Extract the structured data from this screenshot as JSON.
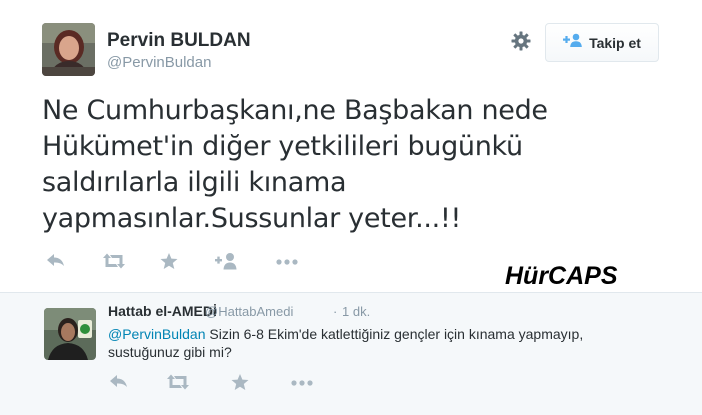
{
  "tweet": {
    "author_name": "Pervin BULDAN",
    "author_handle": "@PervinBuldan",
    "follow_label": "Takip et",
    "text_lines": [
      "Ne Cumhurbaşkanı,ne Başbakan nede",
      "Hükümet'in diğer yetkilileri bugünkü",
      "saldırılarla ilgili kınama",
      "yapmasınlar.Sussunlar yeter...!!"
    ],
    "actions": [
      "reply-icon",
      "retweet-icon",
      "favorite-icon",
      "follow-icon",
      "more-icon"
    ]
  },
  "watermark": "HürCAPS",
  "reply": {
    "author_name": "Hattab el-AMEDİ",
    "author_handle": "@HattabAmedi",
    "separator": "·",
    "time": "1 dk.",
    "mention": "@PervinBuldan",
    "text_line1": " Sizin 6-8 Ekim'de katlettiğiniz gençler için kınama yapmayıp,",
    "text_line2": "sustuğunuz gibi mi?",
    "actions": [
      "reply-icon",
      "retweet-icon",
      "favorite-icon",
      "more-icon"
    ]
  },
  "colors": {
    "icon": "#aab8c2",
    "link": "#0084b4",
    "follow_icon": "#55acee",
    "reply_bg": "#f5f8fa"
  }
}
